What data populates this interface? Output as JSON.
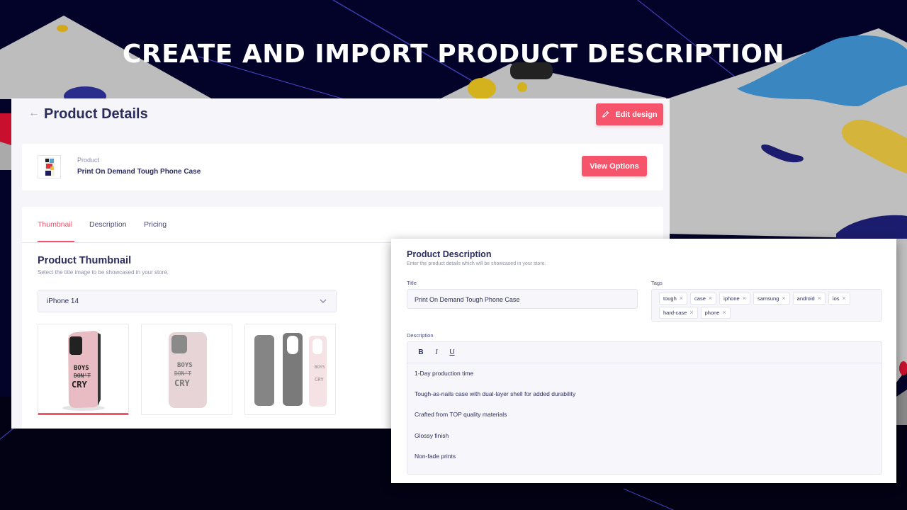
{
  "headline": "CREATE AND IMPORT PRODUCT DESCRIPTION",
  "colors": {
    "accent": "#f5546b",
    "background": "#03032a",
    "text_primary": "#2b2d5c",
    "text_muted": "#8b8ea8"
  },
  "product_details": {
    "back_icon": "arrow-left-icon",
    "title": "Product Details",
    "edit_design_label": "Edit design",
    "edit_icon": "pencil-icon",
    "product_card": {
      "label": "Product",
      "name": "Print On Demand Tough Phone Case",
      "view_options_label": "View Options"
    },
    "tabs": [
      {
        "label": "Thumbnail",
        "active": true
      },
      {
        "label": "Description",
        "active": false
      },
      {
        "label": "Pricing",
        "active": false
      }
    ],
    "thumbnail_section": {
      "title": "Product Thumbnail",
      "subtitle": "Select the title image to be showcased in your store.",
      "model_select_value": "iPhone 14",
      "images": [
        {
          "alt": "Pink phone case angled view - BOYS DON'T CRY",
          "selected": true
        },
        {
          "alt": "Pink phone case back view - BOYS DON'T CRY",
          "selected": false
        },
        {
          "alt": "Phone case layers exploded view",
          "selected": false
        }
      ]
    }
  },
  "product_description": {
    "title": "Product Description",
    "subtitle": "Enter the product details which will be showcased in your store.",
    "title_label": "Title",
    "title_value": "Print On Demand Tough Phone Case",
    "tags_label": "Tags",
    "tags": [
      "tough",
      "case",
      "iphone",
      "samsung",
      "android",
      "ios",
      "hard-case",
      "phone"
    ],
    "description_label": "Description",
    "toolbar": {
      "bold": "B",
      "italic": "I",
      "underline": "U"
    },
    "description_lines": [
      "1-Day production time",
      "Tough-as-nails case with dual-layer shell for added durability",
      "Crafted from TOP quality materials",
      "Glossy finish",
      "Non-fade prints"
    ]
  }
}
